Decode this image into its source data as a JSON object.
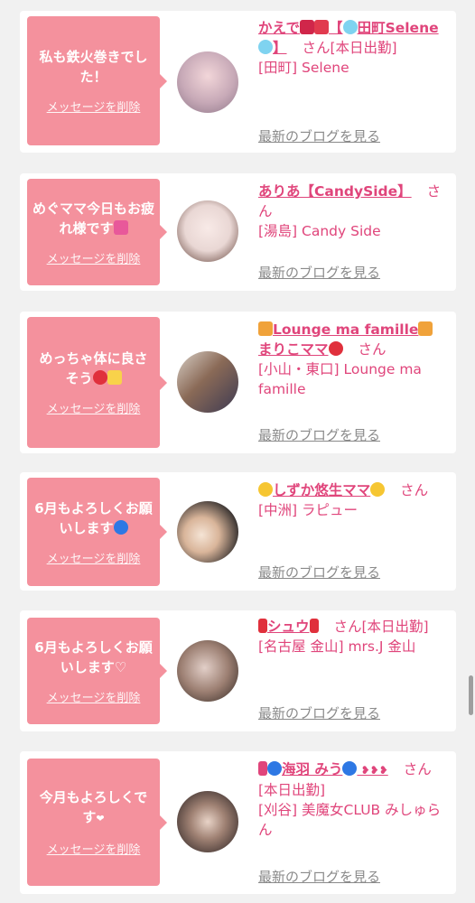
{
  "delete_label": "メッセージを削除",
  "blog_label": "最新のブログを見る",
  "san_label": "さん",
  "cards": [
    {
      "message": "私も鉄火巻きでした！",
      "name_pre": "かえで",
      "name_main": "【",
      "name_tail": "田町Selene",
      "name_end": "】",
      "suffix": "[本日出勤]",
      "shop": "[田町] Selene",
      "avatar_color": "#c7a9b7"
    },
    {
      "message": "めぐママ今日もお疲れ様です",
      "name_pre": "ありあ【CandySide】",
      "suffix": "",
      "shop": "[湯島] Candy Side",
      "avatar_color": "#e9d7d4"
    },
    {
      "message": "めっちゃ体に良さそう",
      "name_pre": "Lounge ma famille",
      "name_line2": "まりこママ",
      "suffix": "",
      "shop": "[小山・東口] Lounge ma famille",
      "avatar_color": "#8a6a57"
    },
    {
      "message": "6月もよろしくお願いします",
      "name_pre": "しずか悠生ママ",
      "suffix": "",
      "shop": "[中洲] ラピュー",
      "avatar_color": "#3a3432"
    },
    {
      "message": "6月もよろしくお願いします♡",
      "name_pre": "シュウ",
      "suffix": "[本日出勤]",
      "shop": "[名古屋 金山] mrs.J 金山",
      "avatar_color": "#9c7f72"
    },
    {
      "message": "今月もよろしくです",
      "name_pre": "海羽 みう",
      "suffix": "[本日出勤]",
      "shop": "[刈谷] 美魔女CLUB みしゅらん",
      "avatar_color": "#4d3e3a"
    }
  ]
}
